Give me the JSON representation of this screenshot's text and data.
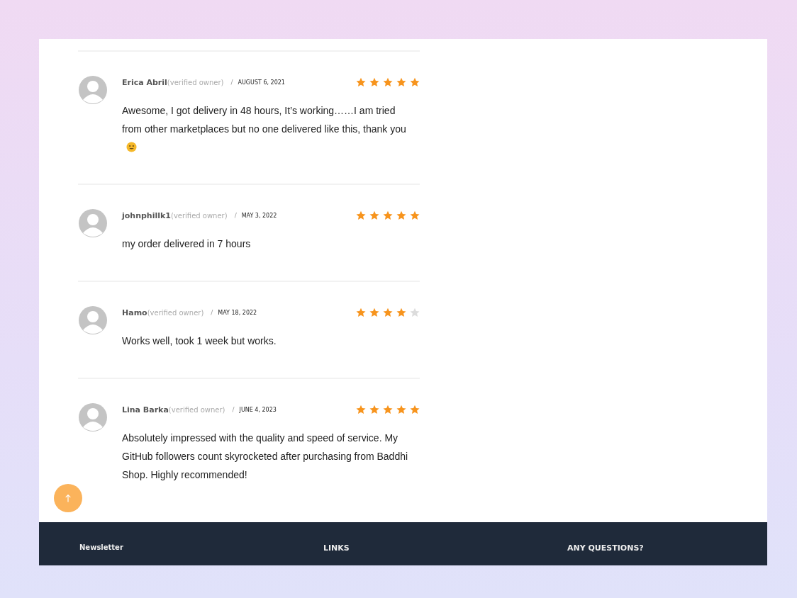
{
  "separator": "/",
  "reviews": [
    {
      "author": "Erica Abril",
      "badge": "(verified owner)",
      "date": "AUGUST 6, 2021",
      "stars": 5,
      "text": "Awesome, I got delivery in 48 hours, It’s working……I am tried from other marketplaces but no one delivered like this, thank you",
      "smiley": true
    },
    {
      "author": "johnphillk1",
      "badge": "(verified owner)",
      "date": "MAY 3, 2022",
      "stars": 5,
      "text": "my order delivered in 7 hours",
      "smiley": false
    },
    {
      "author": "Hamo",
      "badge": "(verified owner)",
      "date": "MAY 18, 2022",
      "stars": 4,
      "text": "Works well, took 1 week but works.",
      "smiley": false
    },
    {
      "author": "Lina Barka",
      "badge": "(verified owner)",
      "date": "JUNE 4, 2023",
      "stars": 5,
      "text": "Absolutely impressed with the quality and speed of service. My GitHub followers count skyrocketed after purchasing from Baddhi Shop. Highly recommended!",
      "smiley": false
    }
  ],
  "footer": {
    "columns": [
      "Newsletter",
      "LINKS",
      "ANY QUESTIONS?"
    ]
  }
}
